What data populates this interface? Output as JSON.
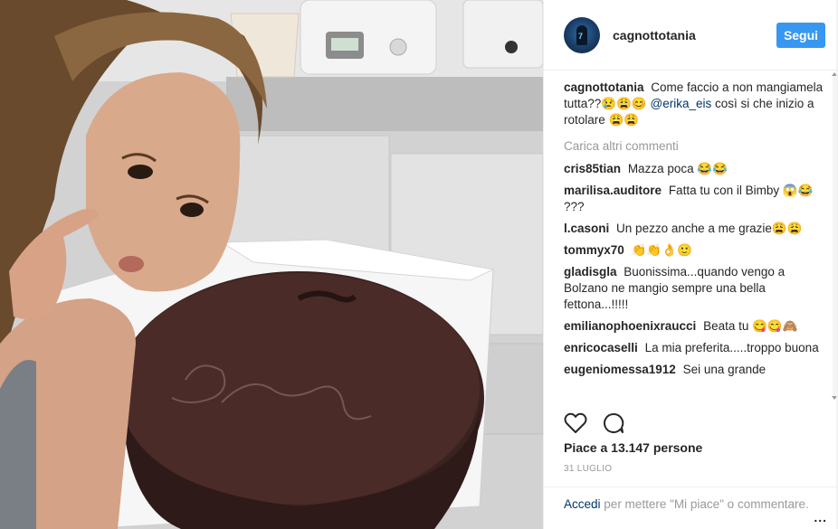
{
  "post": {
    "username": "cagnottotania",
    "follow_label": "Segui",
    "caption": {
      "user": "cagnottotania",
      "text_before": "Come faccio a non mangiamela tutta??😢😩😊",
      "mention": "@erika_eis",
      "text_after": "così si che inizio a rotolare 😩😩"
    },
    "load_more": "Carica altri commenti",
    "comments": [
      {
        "user": "cris85tian",
        "text": "Mazza poca 😂😂"
      },
      {
        "user": "marilisa.auditore",
        "text": "Fatta tu con il Bimby 😱😂 ???"
      },
      {
        "user": "l.casoni",
        "text": "Un pezzo anche a me grazie😩😩"
      },
      {
        "user": "tommyx70",
        "text": "👏👏👌🙂"
      },
      {
        "user": "gladisgla",
        "text": "Buonissima...quando vengo a Bolzano ne mangio sempre una bella fettona...!!!!!"
      },
      {
        "user": "emilianophoenixraucci",
        "text": "Beata tu 😋😋🙈"
      },
      {
        "user": "enricocaselli",
        "text": "La mia preferita.....troppo buona"
      },
      {
        "user": "eugeniomessa1912",
        "text": "Sei una grande"
      }
    ],
    "likes": "Piace a 13.147 persone",
    "date": "31 LUGLIO",
    "login": {
      "link": "Accedi",
      "text": "per mettere \"Mi piace\" o commentare."
    },
    "more": "..."
  },
  "icons": {
    "like": "heart-icon",
    "comment": "comment-bubble-icon",
    "more": "more-options-icon"
  },
  "colors": {
    "follow_button": "#3897f0",
    "mention": "#003569",
    "muted": "#999999",
    "text": "#262626"
  }
}
